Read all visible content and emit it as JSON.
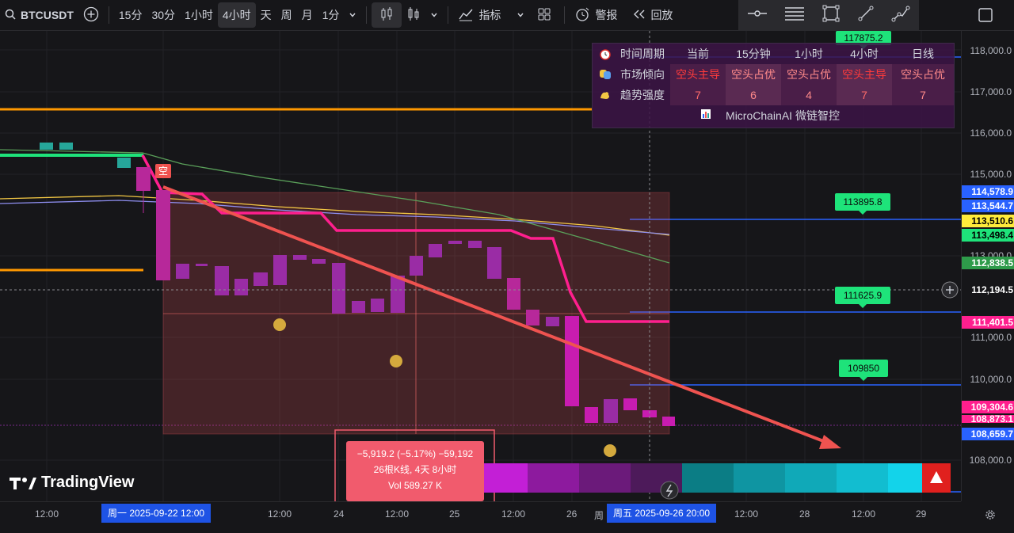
{
  "toolbar": {
    "symbol": "BTCUSDT",
    "intervals": [
      "15分",
      "30分",
      "1小时",
      "4小时",
      "天",
      "周",
      "月",
      "1分"
    ],
    "selected_interval": "4小时",
    "indicators_label": "指标",
    "alert_label": "警报",
    "replay_label": "回放"
  },
  "info_panel": {
    "headers": [
      "时间周期",
      "当前",
      "15分钟",
      "1小时",
      "4小时",
      "日线"
    ],
    "row1_label": "市场倾向",
    "row1_values": [
      "空头主导",
      "空头占优",
      "空头占优",
      "空头主导",
      "空头占优"
    ],
    "row2_label": "趋势强度",
    "row2_values": [
      "7",
      "6",
      "4",
      "7",
      "7"
    ],
    "footer": "MicroChainAI 微链智控",
    "colors": {
      "dominant": "#ff4d4f",
      "advantage": "#ff8a8a"
    }
  },
  "price_scale": {
    "labels": [
      "118,000.0",
      "117,000.0",
      "116,000.0",
      "115,000.0",
      "113,000.0",
      "111,000.0",
      "110,000.0",
      "108,000.0"
    ],
    "tags": [
      {
        "text": "114,578.9",
        "bg": "#2962ff",
        "fg": "#ffffff"
      },
      {
        "text": "113,544.7",
        "bg": "#2962ff",
        "fg": "#ffffff"
      },
      {
        "text": "113,510.6",
        "bg": "#ffeb3b",
        "fg": "#000000"
      },
      {
        "text": "113,498.4",
        "bg": "#1ee37a",
        "fg": "#000000"
      },
      {
        "text": "112,838.5",
        "bg": "#2e9b4a",
        "fg": "#ffffff"
      },
      {
        "text": "112,194.5",
        "bg": "#161619",
        "fg": "#ffffff"
      },
      {
        "text": "111,401.5",
        "bg": "#ff1f8e",
        "fg": "#ffffff"
      },
      {
        "text": "109,304.6",
        "bg": "#ff1f8e",
        "fg": "#ffffff"
      },
      {
        "text": "108,873.1",
        "bg": "#ff1f8e",
        "fg": "#ffffff"
      },
      {
        "text": "108,659.7",
        "bg": "#2962ff",
        "fg": "#ffffff"
      }
    ]
  },
  "green_tags": [
    "117875.2",
    "113895.8",
    "111625.9",
    "109850"
  ],
  "short_marker": "空",
  "tooltip": {
    "line1": "−5,919.2 (−5.17%) −59,192",
    "line2": "26根K线, 4天 8小时",
    "line3": "Vol 589.27 K"
  },
  "time_scale": {
    "labels": [
      "12:00",
      "12:00",
      "24",
      "12:00",
      "25",
      "12:00",
      "26",
      "12:00",
      "28",
      "12:00",
      "29"
    ],
    "range_start": "周一 2025-09-22   12:00",
    "range_end": "周五 2025-09-26   20:00",
    "partial": "周"
  },
  "watermark": "TradingView"
}
